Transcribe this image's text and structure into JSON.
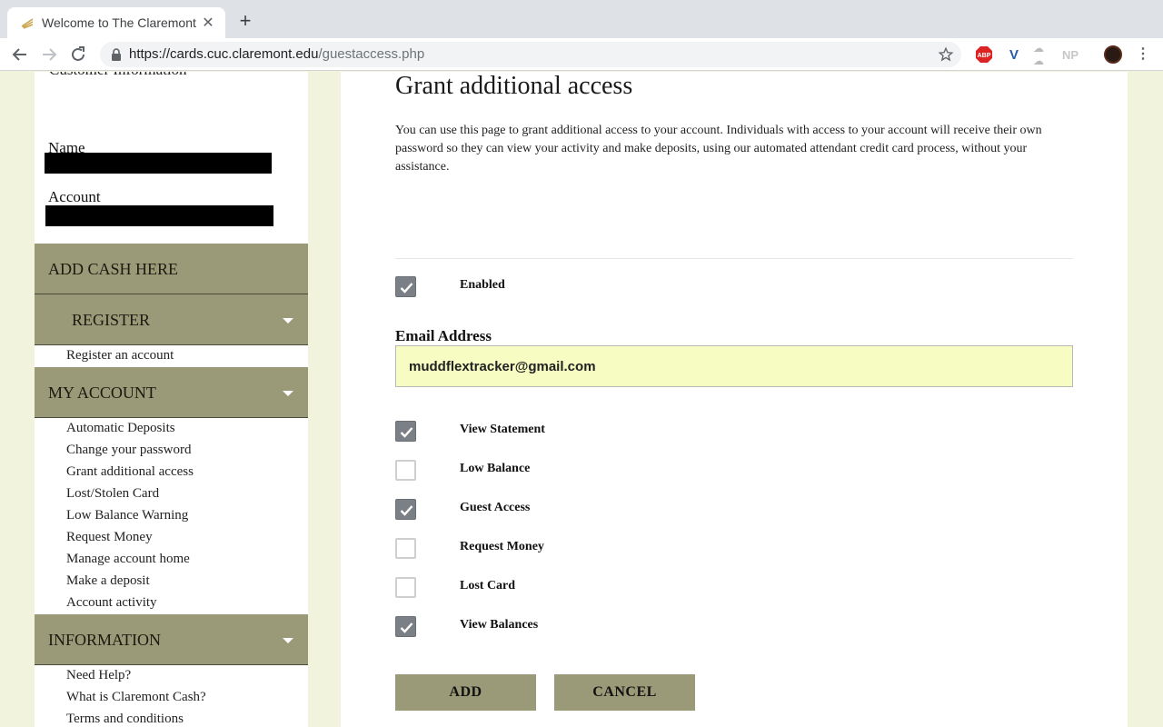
{
  "browser": {
    "tab_title": "Welcome to The Claremont Co",
    "url_host": "https://cards.cuc.claremont.edu",
    "url_path": "/guestaccess.php",
    "extensions": [
      "ABP",
      "V",
      "NP"
    ]
  },
  "sidebar": {
    "customer_info_heading": "Customer Information",
    "name_label": "Name",
    "account_label": "Account",
    "add_cash": "ADD CASH HERE",
    "register": {
      "heading": "REGISTER",
      "links": [
        "Register an account"
      ]
    },
    "my_account": {
      "heading": "MY ACCOUNT",
      "links": [
        "Automatic Deposits",
        "Change your password",
        "Grant additional access",
        "Lost/Stolen Card",
        "Low Balance Warning",
        "Request Money",
        "Manage account home",
        "Make a deposit",
        "Account activity"
      ]
    },
    "information": {
      "heading": "INFORMATION",
      "links": [
        "Need Help?",
        "What is Claremont Cash?",
        "Terms and conditions"
      ]
    }
  },
  "main": {
    "title": "Grant additional access",
    "intro": "You can use this page to grant additional access to your account. Individuals with access to your account will receive their own password so they can view your activity and make deposits, using our automated attendant credit card process, without your assistance.",
    "enabled_label": "Enabled",
    "enabled_checked": true,
    "email_label": "Email Address",
    "email_value": "muddflextracker@gmail.com",
    "permissions": [
      {
        "label": "View Statement",
        "checked": true
      },
      {
        "label": "Low Balance",
        "checked": false
      },
      {
        "label": "Guest Access",
        "checked": true
      },
      {
        "label": "Request Money",
        "checked": false
      },
      {
        "label": "Lost Card",
        "checked": false
      },
      {
        "label": "View Balances",
        "checked": true
      }
    ],
    "add_button": "ADD",
    "cancel_button": "CANCEL"
  }
}
